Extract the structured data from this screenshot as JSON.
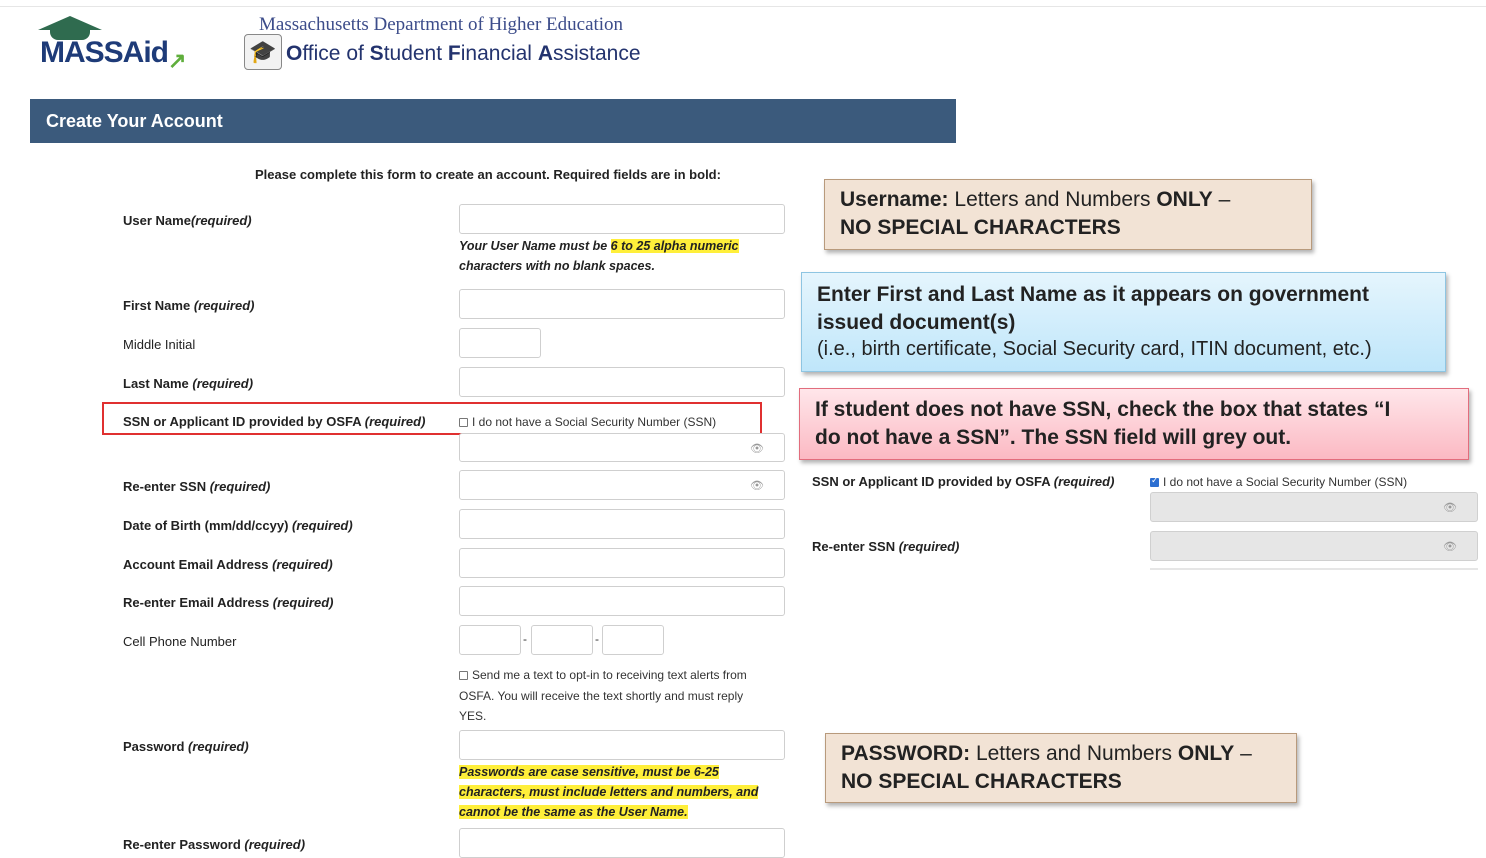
{
  "header": {
    "logo_text": "MASSAid",
    "dept_name": "Massachusetts Department of Higher Education",
    "office_name_parts": [
      "O",
      "ffice of ",
      "S",
      "tudent ",
      "F",
      "inancial ",
      "A",
      "ssistance"
    ]
  },
  "form": {
    "title": "Create Your Account",
    "intro": "Please complete this form to create an account.  Required fields are in bold:",
    "fields": {
      "username_label": "User Name",
      "username_req": "(required)",
      "username_hint_pre": "Your User Name must be ",
      "username_hint_hl": "6 to 25 alpha numeric",
      "username_hint_post": "characters with no blank spaces.",
      "firstname_label": "First Name ",
      "firstname_req": "(required)",
      "middle_label": "Middle Initial",
      "lastname_label": "Last Name ",
      "lastname_req": "(required)",
      "ssn_label": "SSN or Applicant ID provided by OSFA ",
      "ssn_req": "(required)",
      "no_ssn_checkbox": "I do not have a Social Security Number (SSN)",
      "reenter_ssn_label": "Re-enter SSN ",
      "reenter_ssn_req": "(required)",
      "dob_label": "Date of Birth (mm/dd/ccyy) ",
      "dob_req": "(required)",
      "email_label": "Account Email Address ",
      "email_req": "(required)",
      "reemail_label": "Re-enter Email Address ",
      "reemail_req": "(required)",
      "cell_label": "Cell Phone Number",
      "dash": "-",
      "text_opt_line1": "Send me a text to opt-in to receiving text alerts from",
      "text_opt_line2": "OSFA. You will receive the text shortly and must reply",
      "text_opt_line3": "YES.",
      "password_label": "Password ",
      "password_req": "(required)",
      "password_hint_line1": "Passwords are case sensitive, must be 6-25",
      "password_hint_line2": "characters, must include letters and numbers, and",
      "password_hint_line3": "cannot be the same as the User Name.",
      "repassword_label": "Re-enter Password ",
      "repassword_req": "(required)"
    }
  },
  "callouts": {
    "username": {
      "bold": "Username:",
      "text": " Letters and Numbers ",
      "bold2": "ONLY",
      "tail": " –",
      "red": "NO SPECIAL CHARACTERS"
    },
    "name": {
      "line1": "Enter First and Last Name as it appears on government",
      "line2": "issued document(s)",
      "line3": "(i.e., birth certificate, Social Security card, ITIN document, etc.)"
    },
    "ssn": {
      "line1": "If student does not have SSN, check the box that states “I",
      "line2": "do not have a SSN”.  The SSN field will grey out."
    },
    "password": {
      "bold": "PASSWORD:",
      "text": " Letters and Numbers ",
      "bold2": "ONLY",
      "tail": " –",
      "red": "NO SPECIAL CHARACTERS"
    }
  },
  "example": {
    "ssn_label": "SSN or Applicant ID provided by OSFA ",
    "ssn_req": "(required)",
    "checkbox": "I do not have a Social Security Number (SSN)",
    "reenter_label": "Re-enter SSN ",
    "reenter_req": "(required)"
  },
  "icons": {
    "eye": "👁",
    "cap": "🎓",
    "arrow": "↗"
  },
  "colors": {
    "header_bar": "#3b5a7c",
    "highlight": "#ffef3a",
    "alert_red": "#c81818",
    "logo_blue": "#1e3b78",
    "frame_red": "#e03030"
  }
}
